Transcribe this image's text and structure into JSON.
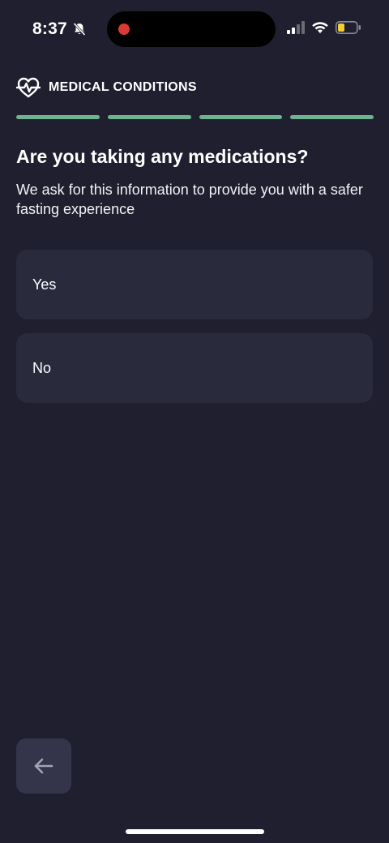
{
  "status_bar": {
    "time": "8:37",
    "icons": [
      "bell-slash-icon",
      "cellular-signal-icon",
      "wifi-icon",
      "battery-icon"
    ],
    "recording_indicator_color": "#d93a35"
  },
  "header": {
    "icon": "heart-pulse-icon",
    "title": "MEDICAL CONDITIONS"
  },
  "progress": {
    "segments_total": 4,
    "segments_complete": 4,
    "color": "#6db38f"
  },
  "question": {
    "title": "Are you taking any medications?",
    "subtitle": "We ask for this information to provide you with a safer fasting experience"
  },
  "options": [
    {
      "label": "Yes"
    },
    {
      "label": "No"
    }
  ],
  "navigation": {
    "back_icon": "arrow-left-icon"
  },
  "colors": {
    "background": "#1f1f30",
    "card": "#2a2a3d",
    "back_button": "#34344a",
    "accent": "#6db38f"
  }
}
